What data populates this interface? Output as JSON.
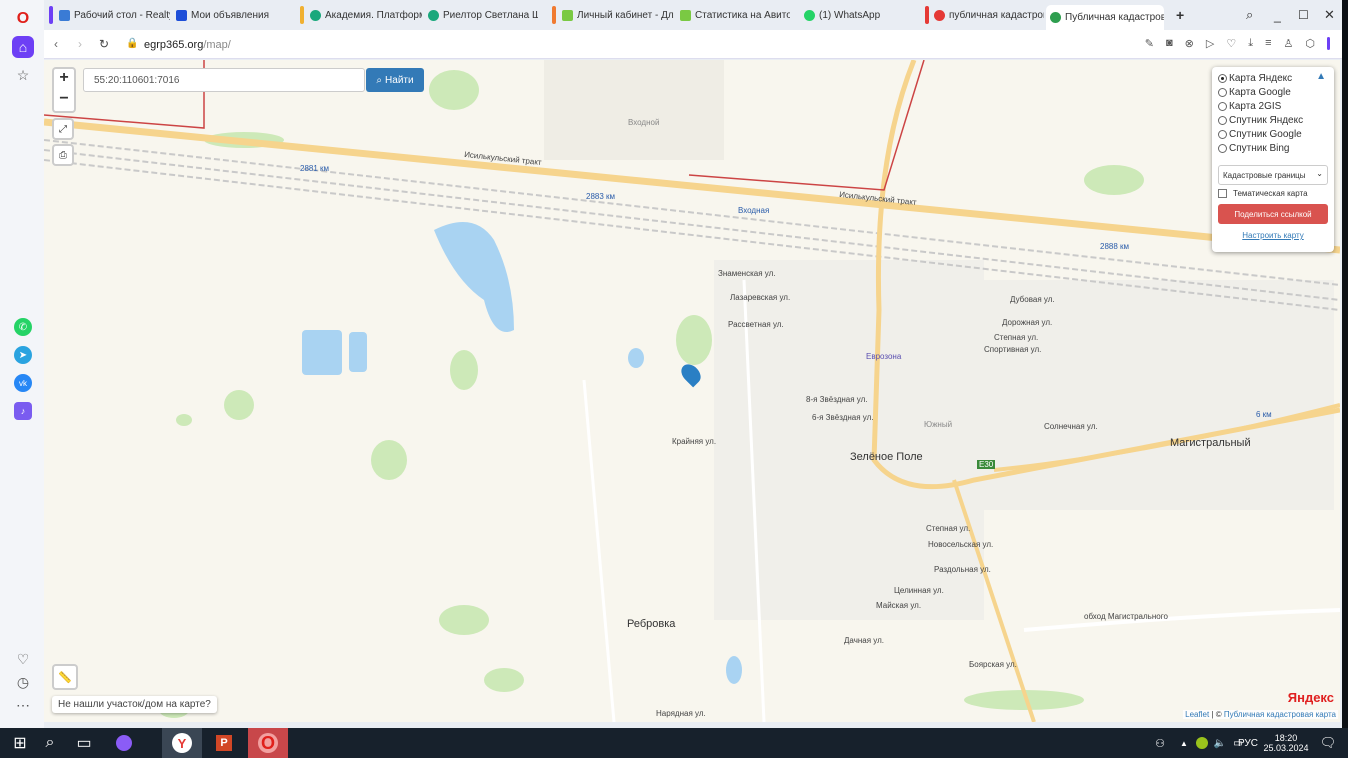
{
  "browser": {
    "tabs": [
      {
        "label": "Рабочий стол - RealtyRu",
        "color": "#3a7bd5"
      },
      {
        "label": "Мои объявления",
        "color": "#1d4ed8"
      },
      {
        "label": "Академия. Платформа з",
        "color": "#1aa87c"
      },
      {
        "label": "Риелтор Светлана Шуль",
        "color": "#1aa87c"
      },
      {
        "label": "Личный кабинет - Для п",
        "color": "#7ac943"
      },
      {
        "label": "Статистика на Авито Pro",
        "color": "#7ac943"
      },
      {
        "label": "(1) WhatsApp",
        "color": "#25d366"
      },
      {
        "label": "публичная кадастровая",
        "color": "#e53935"
      },
      {
        "label": "Публичная кадастровая",
        "color": "#2e9e4f"
      }
    ],
    "new_tab": "+",
    "url_host": "egrp365.org",
    "url_path": "/map/"
  },
  "map": {
    "search_value": "55:20:110601:7016",
    "search_button": "Найти",
    "zoom_in": "+",
    "zoom_out": "−",
    "layers": {
      "options": [
        "Карта Яндекс",
        "Карта Google",
        "Карта 2GIS",
        "Спутник Яндекс",
        "Спутник Google",
        "Спутник Bing"
      ],
      "selected": 0,
      "overlay_select": "Кадастровые границы",
      "thematic_label": "Тематическая карта",
      "share_button": "Поделиться ссылкой",
      "configure_link": "Настроить карту"
    },
    "not_found": "Не нашли участок/дом на карте?",
    "attribution_leaflet": "Leaflet",
    "attribution_sep": " | © ",
    "attribution_source": "Публичная кадастровая карта",
    "yandex_logo": "Яндекс",
    "labels": [
      "Исилькульский тракт",
      "Исилькульский тракт",
      "2881 км",
      "2883 км",
      "Входная",
      "2888 км",
      "Зелёное Поле",
      "Магистральный",
      "Ребровка",
      "Еврозона",
      "Знаменская ул.",
      "Лазаревская ул.",
      "Рассветная ул.",
      "Дубовая ул.",
      "Дорожная ул.",
      "Степная ул.",
      "Спортивная ул.",
      "Крайняя ул.",
      "8-я Звёздная ул.",
      "6-я Звёздная ул.",
      "Степная ул.",
      "Новосельская ул.",
      "Раздольная ул.",
      "Целинная ул.",
      "Майская ул.",
      "Дачная ул.",
      "Боярская ул.",
      "обход Магистрального",
      "6 км",
      "Южный",
      "Входной",
      "E30",
      "Нарядная ул.",
      "Солнечная ул."
    ]
  },
  "taskbar": {
    "lang": "РУС",
    "time": "18:20",
    "date": "25.03.2024"
  }
}
